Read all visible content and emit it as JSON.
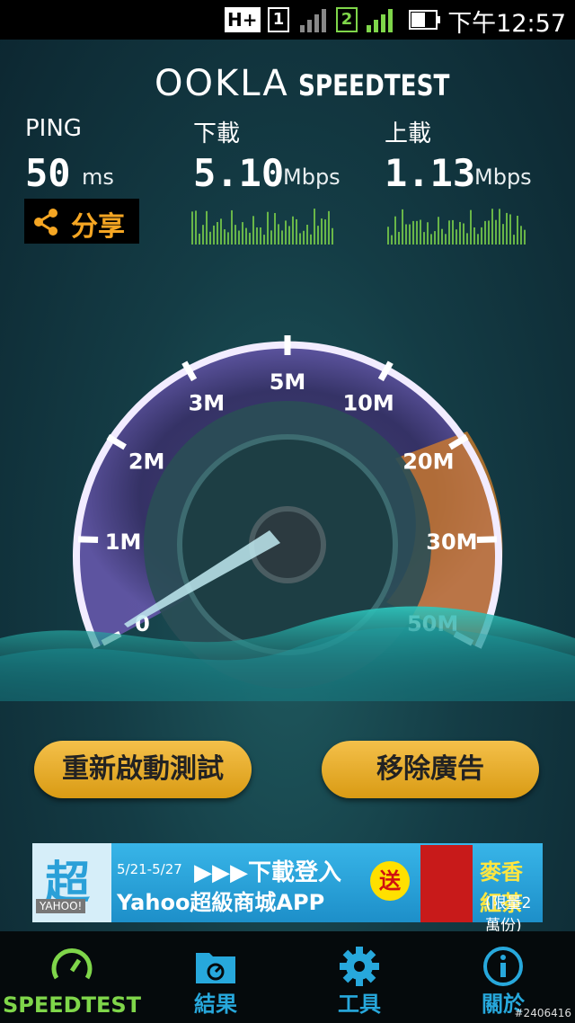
{
  "status_bar": {
    "network": "H+",
    "sim1": "1",
    "sim2": "2",
    "time": "下午12:57"
  },
  "header": {
    "brand": "OOKLA",
    "product": "SPEEDTEST"
  },
  "metrics": {
    "ping": {
      "label": "PING",
      "value": "50",
      "unit": "ms"
    },
    "download": {
      "label": "下載",
      "value": "5.10",
      "unit": "Mbps"
    },
    "upload": {
      "label": "上載",
      "value": "1.13",
      "unit": "Mbps"
    }
  },
  "share_button": {
    "label": "分享",
    "icon": "share-icon"
  },
  "gauge": {
    "tick_labels": [
      "0",
      "1M",
      "2M",
      "3M",
      "5M",
      "10M",
      "20M",
      "30M",
      "50M"
    ],
    "needle_value": "0"
  },
  "buttons": {
    "restart": "重新啟動測試",
    "remove_ads": "移除廣告"
  },
  "ad": {
    "date": "5/21-5/27",
    "line1": "▶▶▶下載登入",
    "line2": "Yahoo超級商城APP",
    "send": "送",
    "product": "麥香紅茶",
    "limit": "(限量2萬份)",
    "brand_char": "超",
    "yahoo": "YAHOO!"
  },
  "tabs": [
    {
      "label": "SPEEDTEST",
      "icon": "speedometer-icon",
      "active": true
    },
    {
      "label": "結果",
      "icon": "results-folder-icon",
      "active": false
    },
    {
      "label": "工具",
      "icon": "gear-icon",
      "active": false
    },
    {
      "label": "關於",
      "icon": "info-icon",
      "active": false
    }
  ],
  "watermark": "#2406416",
  "colors": {
    "accent_green": "#7fd64a",
    "accent_blue": "#27a8dc",
    "button_gold": "#e8ad2a",
    "share_orange": "#f5a623"
  }
}
